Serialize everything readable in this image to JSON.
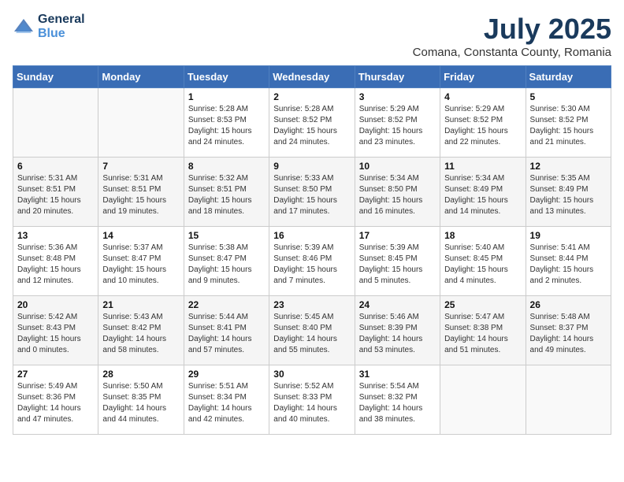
{
  "header": {
    "logo_line1": "General",
    "logo_line2": "Blue",
    "month": "July 2025",
    "location": "Comana, Constanta County, Romania"
  },
  "days_of_week": [
    "Sunday",
    "Monday",
    "Tuesday",
    "Wednesday",
    "Thursday",
    "Friday",
    "Saturday"
  ],
  "weeks": [
    [
      {
        "day": "",
        "info": ""
      },
      {
        "day": "",
        "info": ""
      },
      {
        "day": "1",
        "info": "Sunrise: 5:28 AM\nSunset: 8:53 PM\nDaylight: 15 hours and 24 minutes."
      },
      {
        "day": "2",
        "info": "Sunrise: 5:28 AM\nSunset: 8:52 PM\nDaylight: 15 hours and 24 minutes."
      },
      {
        "day": "3",
        "info": "Sunrise: 5:29 AM\nSunset: 8:52 PM\nDaylight: 15 hours and 23 minutes."
      },
      {
        "day": "4",
        "info": "Sunrise: 5:29 AM\nSunset: 8:52 PM\nDaylight: 15 hours and 22 minutes."
      },
      {
        "day": "5",
        "info": "Sunrise: 5:30 AM\nSunset: 8:52 PM\nDaylight: 15 hours and 21 minutes."
      }
    ],
    [
      {
        "day": "6",
        "info": "Sunrise: 5:31 AM\nSunset: 8:51 PM\nDaylight: 15 hours and 20 minutes."
      },
      {
        "day": "7",
        "info": "Sunrise: 5:31 AM\nSunset: 8:51 PM\nDaylight: 15 hours and 19 minutes."
      },
      {
        "day": "8",
        "info": "Sunrise: 5:32 AM\nSunset: 8:51 PM\nDaylight: 15 hours and 18 minutes."
      },
      {
        "day": "9",
        "info": "Sunrise: 5:33 AM\nSunset: 8:50 PM\nDaylight: 15 hours and 17 minutes."
      },
      {
        "day": "10",
        "info": "Sunrise: 5:34 AM\nSunset: 8:50 PM\nDaylight: 15 hours and 16 minutes."
      },
      {
        "day": "11",
        "info": "Sunrise: 5:34 AM\nSunset: 8:49 PM\nDaylight: 15 hours and 14 minutes."
      },
      {
        "day": "12",
        "info": "Sunrise: 5:35 AM\nSunset: 8:49 PM\nDaylight: 15 hours and 13 minutes."
      }
    ],
    [
      {
        "day": "13",
        "info": "Sunrise: 5:36 AM\nSunset: 8:48 PM\nDaylight: 15 hours and 12 minutes."
      },
      {
        "day": "14",
        "info": "Sunrise: 5:37 AM\nSunset: 8:47 PM\nDaylight: 15 hours and 10 minutes."
      },
      {
        "day": "15",
        "info": "Sunrise: 5:38 AM\nSunset: 8:47 PM\nDaylight: 15 hours and 9 minutes."
      },
      {
        "day": "16",
        "info": "Sunrise: 5:39 AM\nSunset: 8:46 PM\nDaylight: 15 hours and 7 minutes."
      },
      {
        "day": "17",
        "info": "Sunrise: 5:39 AM\nSunset: 8:45 PM\nDaylight: 15 hours and 5 minutes."
      },
      {
        "day": "18",
        "info": "Sunrise: 5:40 AM\nSunset: 8:45 PM\nDaylight: 15 hours and 4 minutes."
      },
      {
        "day": "19",
        "info": "Sunrise: 5:41 AM\nSunset: 8:44 PM\nDaylight: 15 hours and 2 minutes."
      }
    ],
    [
      {
        "day": "20",
        "info": "Sunrise: 5:42 AM\nSunset: 8:43 PM\nDaylight: 15 hours and 0 minutes."
      },
      {
        "day": "21",
        "info": "Sunrise: 5:43 AM\nSunset: 8:42 PM\nDaylight: 14 hours and 58 minutes."
      },
      {
        "day": "22",
        "info": "Sunrise: 5:44 AM\nSunset: 8:41 PM\nDaylight: 14 hours and 57 minutes."
      },
      {
        "day": "23",
        "info": "Sunrise: 5:45 AM\nSunset: 8:40 PM\nDaylight: 14 hours and 55 minutes."
      },
      {
        "day": "24",
        "info": "Sunrise: 5:46 AM\nSunset: 8:39 PM\nDaylight: 14 hours and 53 minutes."
      },
      {
        "day": "25",
        "info": "Sunrise: 5:47 AM\nSunset: 8:38 PM\nDaylight: 14 hours and 51 minutes."
      },
      {
        "day": "26",
        "info": "Sunrise: 5:48 AM\nSunset: 8:37 PM\nDaylight: 14 hours and 49 minutes."
      }
    ],
    [
      {
        "day": "27",
        "info": "Sunrise: 5:49 AM\nSunset: 8:36 PM\nDaylight: 14 hours and 47 minutes."
      },
      {
        "day": "28",
        "info": "Sunrise: 5:50 AM\nSunset: 8:35 PM\nDaylight: 14 hours and 44 minutes."
      },
      {
        "day": "29",
        "info": "Sunrise: 5:51 AM\nSunset: 8:34 PM\nDaylight: 14 hours and 42 minutes."
      },
      {
        "day": "30",
        "info": "Sunrise: 5:52 AM\nSunset: 8:33 PM\nDaylight: 14 hours and 40 minutes."
      },
      {
        "day": "31",
        "info": "Sunrise: 5:54 AM\nSunset: 8:32 PM\nDaylight: 14 hours and 38 minutes."
      },
      {
        "day": "",
        "info": ""
      },
      {
        "day": "",
        "info": ""
      }
    ]
  ]
}
